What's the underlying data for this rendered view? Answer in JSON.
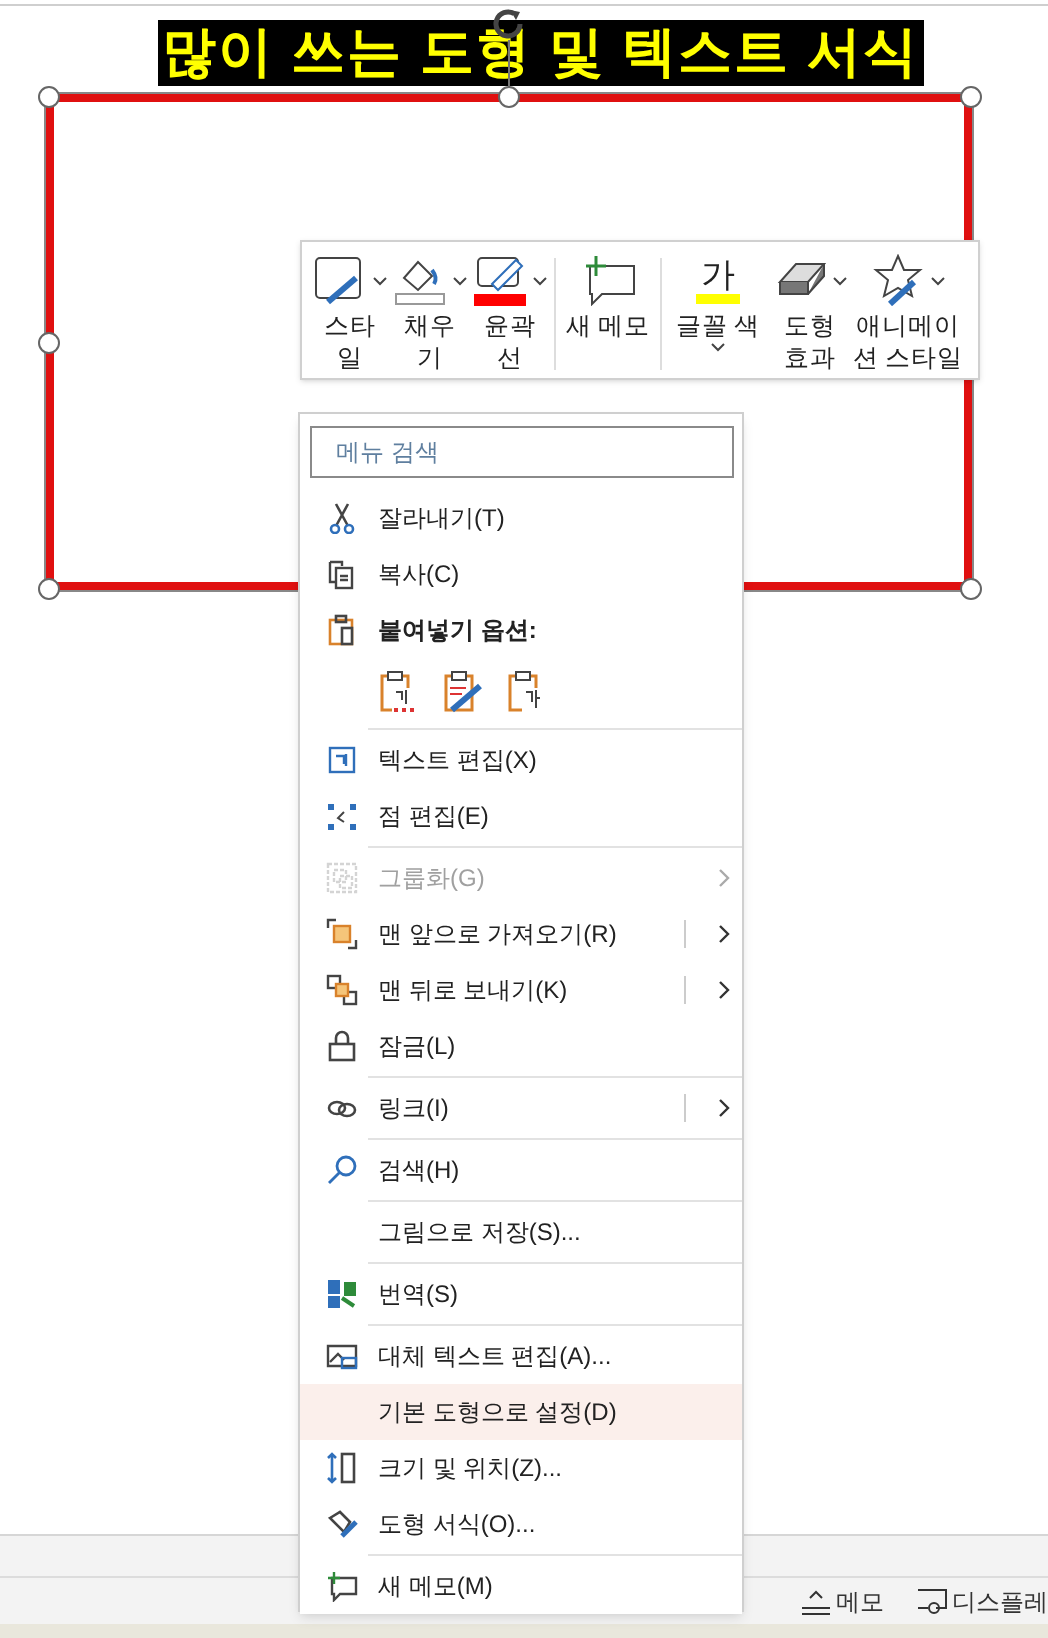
{
  "title": "많이 쓰는 도형 및 텍스트 서식",
  "mini_toolbar": [
    {
      "label": "스타일",
      "dropdown": true
    },
    {
      "label": "채우기",
      "dropdown": true
    },
    {
      "label": "윤곽선",
      "dropdown": true,
      "color": "#ff0000"
    },
    {
      "label": "새 메모",
      "dropdown": false
    },
    {
      "label": "글꼴 색",
      "dropdown": true,
      "color": "#ffff00",
      "glyph": "가"
    },
    {
      "label": "도형 효과",
      "dropdown": true
    },
    {
      "label": "애니메이션 스타일",
      "dropdown": true
    }
  ],
  "context_menu": {
    "search": {
      "placeholder": "메뉴 검색"
    },
    "items": [
      {
        "kind": "item",
        "label": "잘라내기(T)",
        "disabled": false,
        "highlighted": false,
        "submenu": false
      },
      {
        "kind": "item",
        "label": "복사(C)",
        "disabled": false,
        "highlighted": false,
        "submenu": false
      },
      {
        "kind": "header",
        "label": "붙여넣기 옵션:"
      },
      {
        "kind": "paste_options"
      },
      {
        "kind": "separator"
      },
      {
        "kind": "item",
        "label": "텍스트 편집(X)",
        "disabled": false,
        "highlighted": false,
        "submenu": false
      },
      {
        "kind": "item",
        "label": "점 편집(E)",
        "disabled": false,
        "highlighted": false,
        "submenu": false
      },
      {
        "kind": "separator"
      },
      {
        "kind": "item",
        "label": "그룹화(G)",
        "disabled": true,
        "highlighted": false,
        "submenu": true,
        "split": false
      },
      {
        "kind": "item",
        "label": "맨 앞으로 가져오기(R)",
        "disabled": false,
        "highlighted": false,
        "submenu": true,
        "split": true
      },
      {
        "kind": "item",
        "label": "맨 뒤로 보내기(K)",
        "disabled": false,
        "highlighted": false,
        "submenu": true,
        "split": true
      },
      {
        "kind": "item",
        "label": "잠금(L)",
        "disabled": false,
        "highlighted": false,
        "submenu": false
      },
      {
        "kind": "separator"
      },
      {
        "kind": "item",
        "label": "링크(I)",
        "disabled": false,
        "highlighted": false,
        "submenu": true,
        "split": true
      },
      {
        "kind": "separator"
      },
      {
        "kind": "item",
        "label": "검색(H)",
        "disabled": false,
        "highlighted": false,
        "submenu": false
      },
      {
        "kind": "separator"
      },
      {
        "kind": "item",
        "label": "그림으로 저장(S)...",
        "disabled": false,
        "highlighted": false,
        "submenu": false
      },
      {
        "kind": "separator"
      },
      {
        "kind": "item",
        "label": "번역(S)",
        "disabled": false,
        "highlighted": false,
        "submenu": false
      },
      {
        "kind": "separator"
      },
      {
        "kind": "item",
        "label": "대체 텍스트 편집(A)...",
        "disabled": false,
        "highlighted": false,
        "submenu": false
      },
      {
        "kind": "item",
        "label": "기본 도형으로 설정(D)",
        "disabled": false,
        "highlighted": true,
        "submenu": false
      },
      {
        "kind": "item",
        "label": "크기 및 위치(Z)...",
        "disabled": false,
        "highlighted": false,
        "submenu": false
      },
      {
        "kind": "item",
        "label": "도형 서식(O)...",
        "disabled": false,
        "highlighted": false,
        "submenu": false
      },
      {
        "kind": "separator"
      },
      {
        "kind": "item",
        "label": "새 메모(M)",
        "disabled": false,
        "highlighted": false,
        "submenu": false
      }
    ]
  },
  "status_bar": {
    "items": [
      "메모",
      "디스플레"
    ]
  }
}
